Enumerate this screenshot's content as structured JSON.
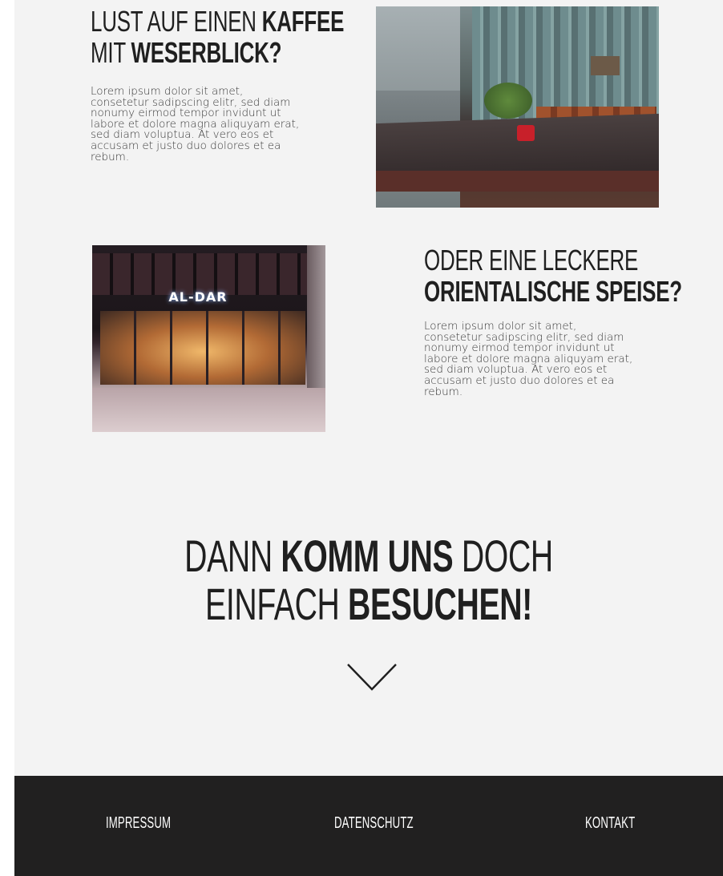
{
  "section1": {
    "heading_light_1": "Lust auf einen ",
    "heading_bold_1": "Kaffee",
    "heading_light_2": "mit ",
    "heading_bold_2": "Weserblick?",
    "text": "Lorem ipsum dolor sit amet, consetetur sadipscing elitr, sed diam nonumy eirmod tempor invidunt ut labore et dolore magna aliquyam erat, sed diam voluptua. At vero eos et accusam et justo duo dolores et ea rebum."
  },
  "section2": {
    "heading_light_1": "Oder eine leckere",
    "heading_bold_2": "orientalische Speise?",
    "text": "Lorem ipsum dolor sit amet, consetetur sadipscing elitr, sed diam nonumy eirmod tempor invidunt ut labore et dolore magna aliquyam erat, sed diam voluptua. At vero eos et accusam et justo duo dolores et ea rebum.",
    "photo_sign": "AL-DAR"
  },
  "cta": {
    "l1_light_a": "Dann ",
    "l1_bold": "komm uns",
    "l1_light_b": " doch",
    "l2_light": "einfach ",
    "l2_bold": "besuchen!",
    "icon": "chevron-down-icon"
  },
  "footer": {
    "impressum": "Impressum",
    "datenschutz": "Datenschutz",
    "kontakt": "Kontakt"
  },
  "colors": {
    "page_bg": "#f3f3f3",
    "text": "#1f1f1f",
    "footer_bg": "#212020",
    "footer_text": "#ffffff"
  }
}
